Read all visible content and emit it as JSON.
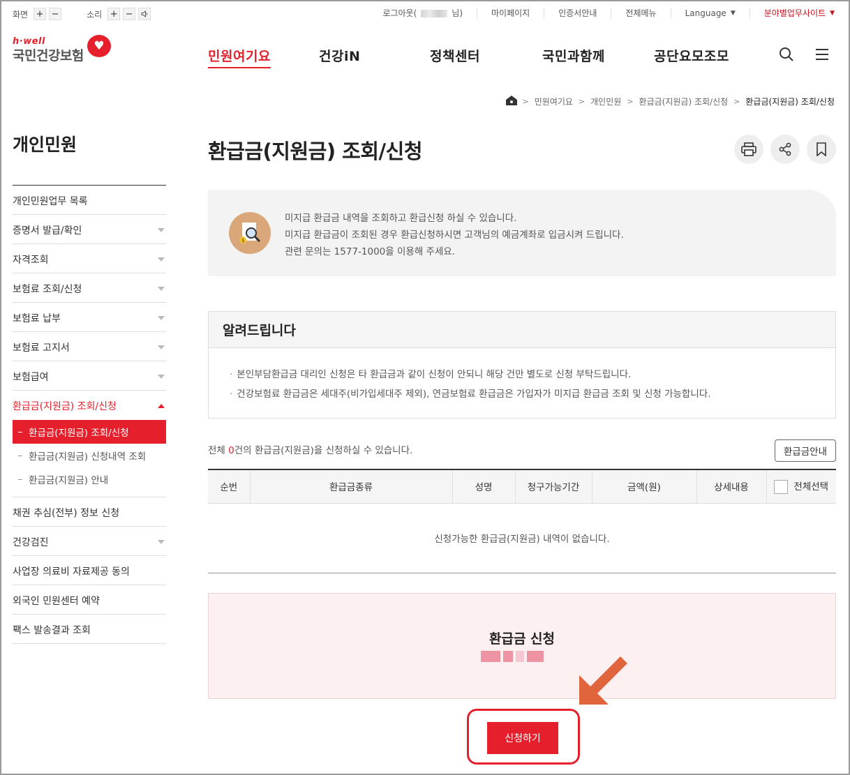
{
  "util": {
    "screen_label": "화면",
    "sound_label": "소리",
    "plus": "+",
    "minus": "−",
    "links": {
      "logout_prefix": "로그아웃(",
      "logout_suffix": "님)",
      "mypage": "마이페이지",
      "cert": "인증서안내",
      "allmenu": "전체메뉴",
      "language": "Language",
      "sites": "분야별업무사이트"
    }
  },
  "logo": {
    "small": "h·well",
    "big": "국민건강보험"
  },
  "gnb": [
    "민원여기요",
    "건강iN",
    "정책센터",
    "국민과함께",
    "공단요모조모"
  ],
  "breadcrumb": [
    "민원여기요",
    "개인민원",
    "환급금(지원금) 조회/신청",
    "환급금(지원금) 조회/신청"
  ],
  "sidebar": {
    "title": "개인민원",
    "items": [
      {
        "label": "개인민원업무 목록"
      },
      {
        "label": "증명서 발급/확인"
      },
      {
        "label": "자격조회"
      },
      {
        "label": "보험료 조회/신청"
      },
      {
        "label": "보험료 납부"
      },
      {
        "label": "보험료 고지서"
      },
      {
        "label": "보험급여"
      },
      {
        "label": "환급금(지원금) 조회/신청"
      },
      {
        "label": "채권 추심(전부) 정보 신청"
      },
      {
        "label": "건강검진"
      },
      {
        "label": "사업장 의료비 자료제공 동의"
      },
      {
        "label": "외국인 민원센터 예약"
      },
      {
        "label": "팩스 발송결과 조회"
      }
    ],
    "sub": [
      "환급금(지원금) 조회/신청",
      "환급금(지원금) 신청내역 조회",
      "환급금(지원금) 안내"
    ]
  },
  "page": {
    "title": "환급금(지원금) 조회/신청",
    "notice": [
      "미지급 환급금 내역을 조회하고 환급신청 하실 수 있습니다.",
      "미지급 환급금이 조회된 경우 환급신청하시면 고객님의 예금계좌로 입금시켜 드립니다.",
      "관련 문의는 1577-1000을 이용해 주세요."
    ],
    "inform_title": "알려드립니다",
    "inform": [
      "본인부담환급금 대리인 신청은 타 환급금과 같이 신청이 안되니 해당 건만 별도로 신청 부탁드립니다.",
      "건강보험료 환급금은 세대주(비가입세대주 제외), 연금보험료 환급금은 가입자가 미지급 환급금 조회 및 신청 가능합니다."
    ],
    "count_prefix": "전체 ",
    "count_num": "0",
    "count_suffix": "건의 환급금(지원금)을 신청하실 수 있습니다.",
    "guide_btn": "환급금안내",
    "columns": [
      "순번",
      "환급금종류",
      "성명",
      "청구가능기간",
      "금액(원)",
      "상세내용",
      "전체선택"
    ],
    "empty": "신청가능한 환급금(지원금) 내역이 없습니다.",
    "apply_title": "환급금 신청",
    "submit": "신청하기"
  },
  "colors": {
    "accent": "#e5202c"
  }
}
